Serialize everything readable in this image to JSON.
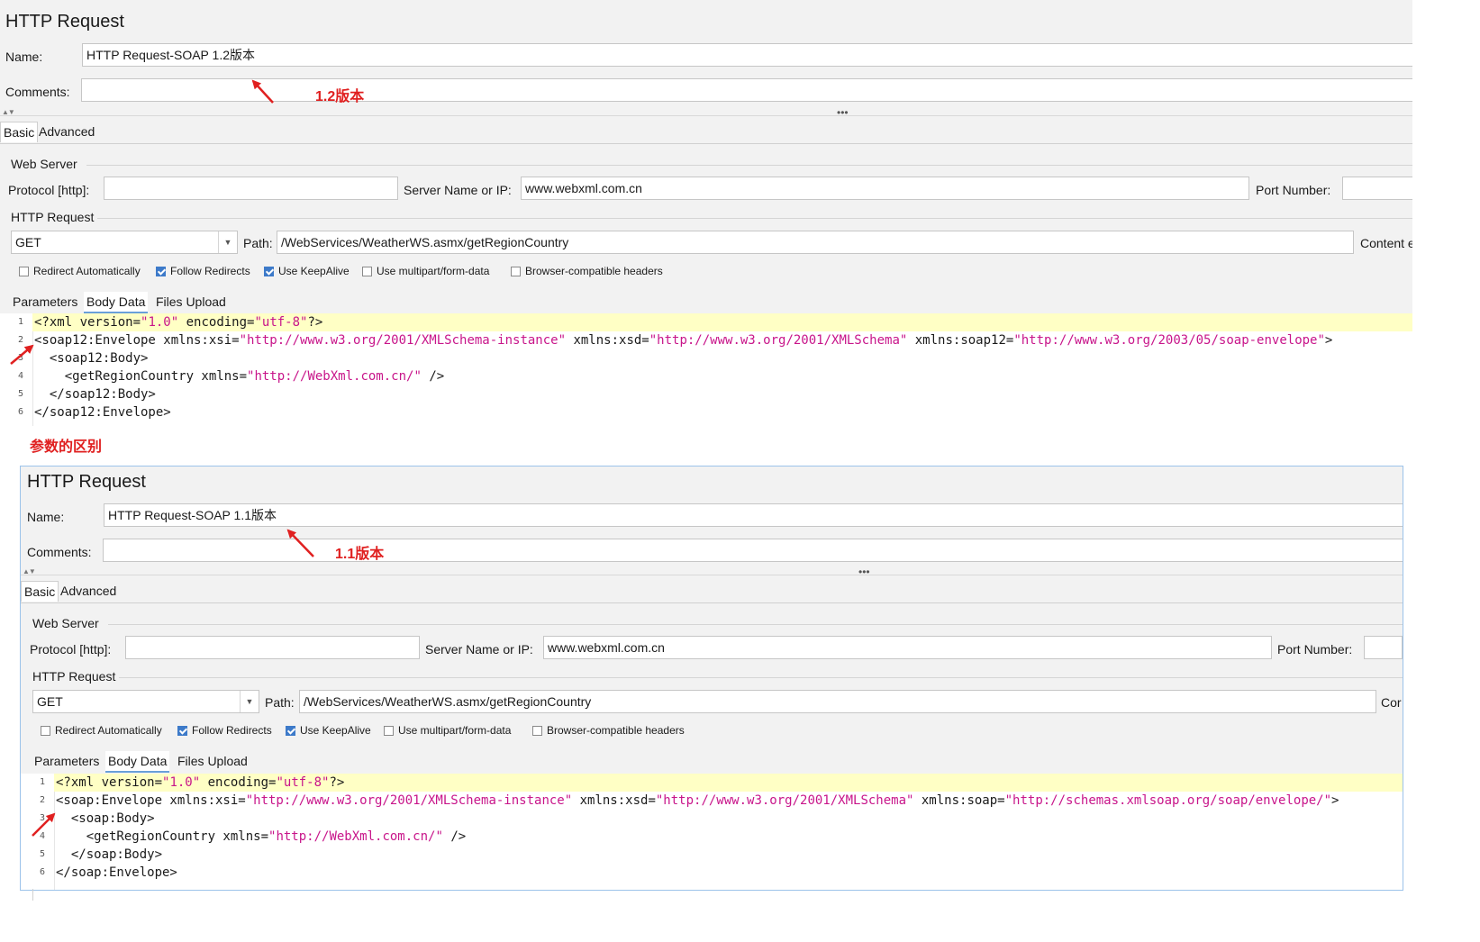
{
  "top": {
    "title": "HTTP Request",
    "name_label": "Name:",
    "name_value": "HTTP Request-SOAP 1.2版本",
    "comments_label": "Comments:",
    "comments_value": "",
    "tabs": [
      "Basic",
      "Advanced"
    ],
    "web_server_title": "Web Server",
    "protocol_label": "Protocol [http]:",
    "protocol_value": "",
    "server_label": "Server Name or IP:",
    "server_value": "www.webxml.com.cn",
    "port_label": "Port Number:",
    "http_request_title": "HTTP Request",
    "method": "GET",
    "path_label": "Path:",
    "path_value": "/WebServices/WeatherWS.asmx/getRegionCountry",
    "content_label": "Content e",
    "checkboxes": [
      {
        "label": "Redirect Automatically",
        "checked": false
      },
      {
        "label": "Follow Redirects",
        "checked": true
      },
      {
        "label": "Use KeepAlive",
        "checked": true
      },
      {
        "label": "Use multipart/form-data",
        "checked": false
      },
      {
        "label": "Browser-compatible headers",
        "checked": false
      }
    ],
    "sub_tabs": [
      "Parameters",
      "Body Data",
      "Files Upload"
    ],
    "code_numbers": [
      "1",
      "2",
      "3",
      "4",
      "5",
      "6"
    ],
    "code": {
      "l1_open": "<?xml version=",
      "l1_v1": "\"1.0\"",
      "l1_mid": " encoding=",
      "l1_v2": "\"utf-8\"",
      "l1_end": "?>",
      "l2_open": "<soap12:Envelope xmlns:xsi=",
      "l2_v1": "\"http://www.w3.org/2001/XMLSchema-instance\"",
      "l2_mid1": " xmlns:xsd=",
      "l2_v2": "\"http://www.w3.org/2001/XMLSchema\"",
      "l2_mid2": " xmlns:soap12=",
      "l2_v3": "\"http://www.w3.org/2003/05/soap-envelope\"",
      "l2_end": ">",
      "l3": "  <soap12:Body>",
      "l4_open": "    <getRegionCountry xmlns=",
      "l4_v": "\"http://WebXml.com.cn/\"",
      "l4_end": " />",
      "l5": "  </soap12:Body>",
      "l6": "</soap12:Envelope>"
    }
  },
  "bottom": {
    "title": "HTTP Request",
    "name_label": "Name:",
    "name_value": "HTTP Request-SOAP 1.1版本",
    "comments_label": "Comments:",
    "comments_value": "",
    "tabs": [
      "Basic",
      "Advanced"
    ],
    "web_server_title": "Web Server",
    "protocol_label": "Protocol [http]:",
    "protocol_value": "",
    "server_label": "Server Name or IP:",
    "server_value": "www.webxml.com.cn",
    "port_label": "Port Number:",
    "http_request_title": "HTTP Request",
    "method": "GET",
    "path_label": "Path:",
    "path_value": "/WebServices/WeatherWS.asmx/getRegionCountry",
    "content_label": "Cor",
    "checkboxes": [
      {
        "label": "Redirect Automatically",
        "checked": false
      },
      {
        "label": "Follow Redirects",
        "checked": true
      },
      {
        "label": "Use KeepAlive",
        "checked": true
      },
      {
        "label": "Use multipart/form-data",
        "checked": false
      },
      {
        "label": "Browser-compatible headers",
        "checked": false
      }
    ],
    "sub_tabs": [
      "Parameters",
      "Body Data",
      "Files Upload"
    ],
    "code_numbers": [
      "1",
      "2",
      "3",
      "4",
      "5",
      "6"
    ],
    "code": {
      "l1_open": "<?xml version=",
      "l1_v1": "\"1.0\"",
      "l1_mid": " encoding=",
      "l1_v2": "\"utf-8\"",
      "l1_end": "?>",
      "l2_open": "<soap:Envelope xmlns:xsi=",
      "l2_v1": "\"http://www.w3.org/2001/XMLSchema-instance\"",
      "l2_mid1": " xmlns:xsd=",
      "l2_v2": "\"http://www.w3.org/2001/XMLSchema\"",
      "l2_mid2": " xmlns:soap=",
      "l2_v3": "\"http://schemas.xmlsoap.org/soap/envelope/\"",
      "l2_end": ">",
      "l3": "  <soap:Body>",
      "l4_open": "    <getRegionCountry xmlns=",
      "l4_v": "\"http://WebXml.com.cn/\"",
      "l4_end": " />",
      "l5": "  </soap:Body>",
      "l6": "</soap:Envelope>"
    }
  },
  "annotations": {
    "version_12": "1.2版本",
    "param_diff": "参数的区别",
    "version_11": "1.1版本",
    "color": "#e02020"
  },
  "colors": {
    "string_value": "#c8158a",
    "current_line": "#ffffc5",
    "checkbox_on": "#3d7ac9",
    "panel_border": "#9cc3ea"
  }
}
